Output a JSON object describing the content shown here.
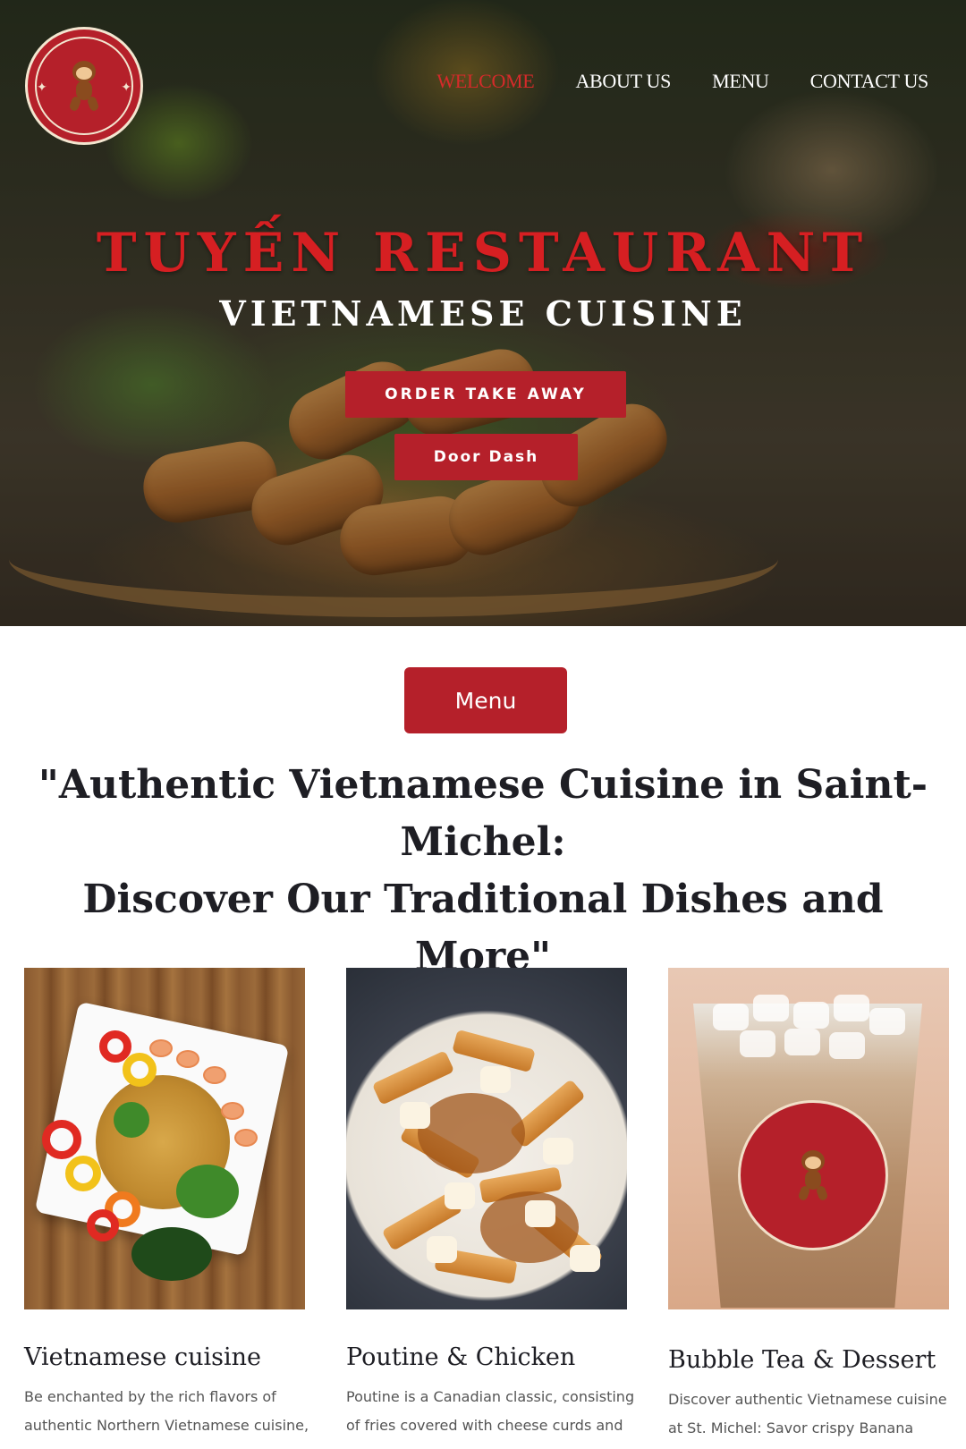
{
  "header": {
    "logo_text": "Tuyen Restaurant",
    "nav": [
      {
        "label": "WELCOME",
        "active": true
      },
      {
        "label": "ABOUT US",
        "active": false
      },
      {
        "label": "MENU",
        "active": false
      },
      {
        "label": "CONTACT US",
        "active": false
      }
    ]
  },
  "hero": {
    "title": "TUYẾN RESTAURANT",
    "subtitle": "VIETNAMESE CUISINE",
    "order_button": "ORDER TAKE AWAY",
    "doordash_button": "Door Dash"
  },
  "menu_section": {
    "menu_button": "Menu",
    "tagline_line1": "\"Authentic Vietnamese Cuisine in Saint-Michel:",
    "tagline_line2": "Discover Our Traditional Dishes and More\""
  },
  "cards": [
    {
      "title": "Vietnamese cuisine",
      "desc_line1": "Be enchanted by the rich flavors of",
      "desc_line2": "authentic Northern Vietnamese cuisine,"
    },
    {
      "title": "Poutine & Chicken",
      "desc_line1": "Poutine is a Canadian classic, consisting",
      "desc_line2": "of fries covered with cheese curds and"
    },
    {
      "title": "Bubble Tea & Dessert",
      "desc_line1": "Discover authentic Vietnamese cuisine",
      "desc_line2": "at St. Michel: Savor crispy Banana"
    }
  ],
  "colors": {
    "brand_red": "#b5202a",
    "nav_active": "#d52a2a",
    "hero_title": "#d61f22"
  }
}
